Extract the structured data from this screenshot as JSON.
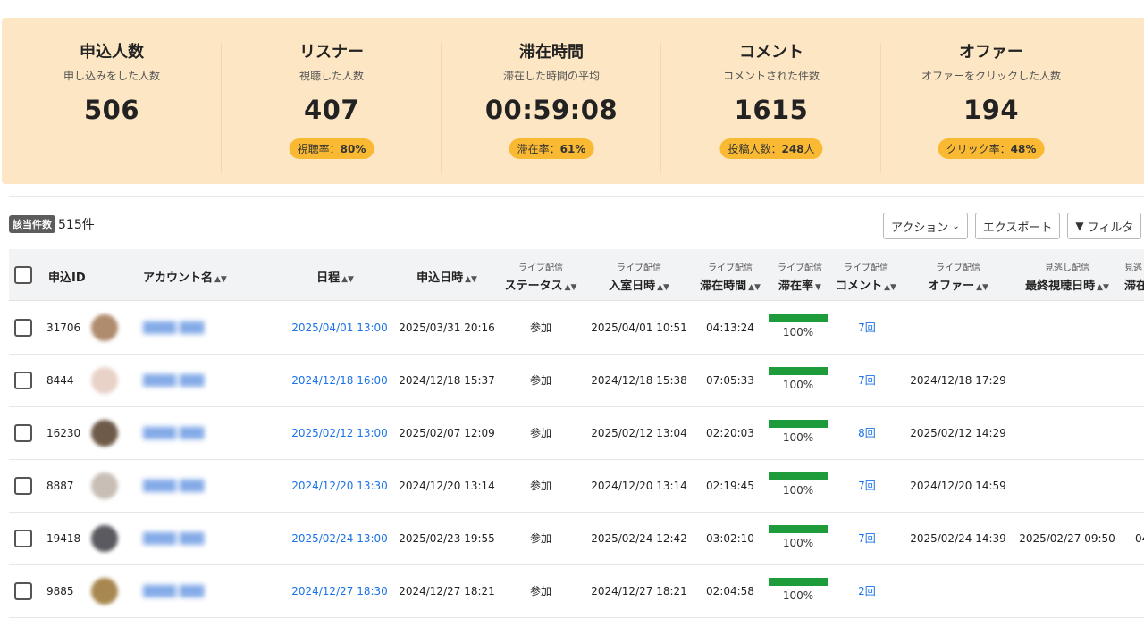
{
  "stats": [
    {
      "title": "申込人数",
      "sub": "申し込みをした人数",
      "value": "506",
      "badge_label": "",
      "badge_value": "",
      "badge_suffix": ""
    },
    {
      "title": "リスナー",
      "sub": "視聴した人数",
      "value": "407",
      "badge_label": "視聴率：",
      "badge_value": "80%",
      "badge_suffix": ""
    },
    {
      "title": "滞在時間",
      "sub": "滞在した時間の平均",
      "value": "00:59:08",
      "badge_label": "滞在率：",
      "badge_value": "61%",
      "badge_suffix": ""
    },
    {
      "title": "コメント",
      "sub": "コメントされた件数",
      "value": "1615",
      "badge_label": "投稿人数：",
      "badge_value": "248",
      "badge_suffix": "人"
    },
    {
      "title": "オファー",
      "sub": "オファーをクリックした人数",
      "value": "194",
      "badge_label": "クリック率：",
      "badge_value": "48%",
      "badge_suffix": ""
    }
  ],
  "count": {
    "tag": "該当件数",
    "text": "515件"
  },
  "toolbar": {
    "action": "アクション",
    "export": "エクスポート",
    "filter": "フィルタ"
  },
  "columns": {
    "id": "申込ID",
    "account": "アカウント名",
    "schedule": "日程",
    "applied": "申込日時",
    "status_pre": "ライブ配信",
    "status": "ステータス",
    "enter_pre": "ライブ配信",
    "enter": "入室日時",
    "stay_pre": "ライブ配信",
    "stay": "滞在時間",
    "rate_pre": "ライブ配信",
    "rate": "滞在率",
    "comment_pre": "ライブ配信",
    "comment": "コメント",
    "offer_pre": "ライブ配信",
    "offer": "オファー",
    "last_pre": "見逃し配信",
    "last": "最終視聴日時",
    "extra_pre": "見逃",
    "extra": "滞在"
  },
  "rows": [
    {
      "id": "31706",
      "schedule": "2025/04/01 13:00",
      "applied": "2025/03/31 20:16",
      "status": "参加",
      "enter": "2025/04/01 10:51",
      "stay": "04:13:24",
      "rate": 100,
      "rate_text": "100%",
      "comment": "7回",
      "offer": "",
      "last": "",
      "extra": "",
      "avatar_color": "#b08c6e"
    },
    {
      "id": "8444",
      "schedule": "2024/12/18 16:00",
      "applied": "2024/12/18 15:37",
      "status": "参加",
      "enter": "2024/12/18 15:38",
      "stay": "07:05:33",
      "rate": 100,
      "rate_text": "100%",
      "comment": "7回",
      "offer": "2024/12/18 17:29",
      "last": "",
      "extra": "",
      "avatar_color": "#e8d2c8"
    },
    {
      "id": "16230",
      "schedule": "2025/02/12 13:00",
      "applied": "2025/02/07 12:09",
      "status": "参加",
      "enter": "2025/02/12 13:04",
      "stay": "02:20:03",
      "rate": 100,
      "rate_text": "100%",
      "comment": "8回",
      "offer": "2025/02/12 14:29",
      "last": "",
      "extra": "",
      "avatar_color": "#6e5a48"
    },
    {
      "id": "8887",
      "schedule": "2024/12/20 13:30",
      "applied": "2024/12/20 13:14",
      "status": "参加",
      "enter": "2024/12/20 13:14",
      "stay": "02:19:45",
      "rate": 100,
      "rate_text": "100%",
      "comment": "7回",
      "offer": "2024/12/20 14:59",
      "last": "",
      "extra": "",
      "avatar_color": "#c8beb6"
    },
    {
      "id": "19418",
      "schedule": "2025/02/24 13:00",
      "applied": "2025/02/23 19:55",
      "status": "参加",
      "enter": "2025/02/24 12:42",
      "stay": "03:02:10",
      "rate": 100,
      "rate_text": "100%",
      "comment": "7回",
      "offer": "2025/02/24 14:39",
      "last": "2025/02/27 09:50",
      "extra": "04",
      "avatar_color": "#5a5a60"
    },
    {
      "id": "9885",
      "schedule": "2024/12/27 18:30",
      "applied": "2024/12/27 18:21",
      "status": "参加",
      "enter": "2024/12/27 18:21",
      "stay": "02:04:58",
      "rate": 100,
      "rate_text": "100%",
      "comment": "2回",
      "offer": "",
      "last": "",
      "extra": "",
      "avatar_color": "#a88850"
    }
  ]
}
